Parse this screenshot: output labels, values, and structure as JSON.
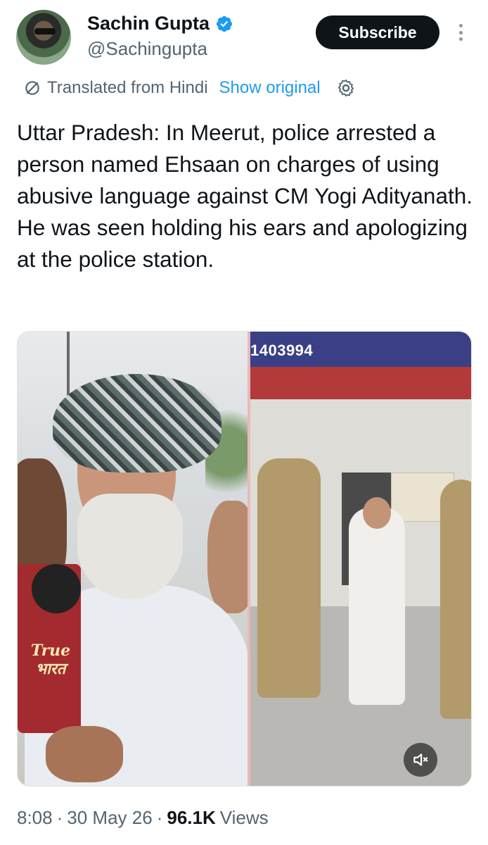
{
  "author": {
    "display_name": "Sachin Gupta",
    "handle": "@Sachingupta",
    "verified": true,
    "avatar_icon": "profile-avatar"
  },
  "actions": {
    "subscribe_label": "Subscribe",
    "more_icon": "vertical-ellipsis-icon"
  },
  "translation": {
    "note": "Translated from Hindi",
    "show_original_label": "Show original",
    "settings_icon": "gear-icon"
  },
  "tweet": {
    "text": "Uttar Pradesh: In Meerut, police arrested a person named Ehsaan on charges of using abusive language against CM Yogi Adityanath. He was seen holding his ears and apologizing at the police station."
  },
  "media": {
    "left_mic_label_line1": "True",
    "left_mic_label_line2": "भारत",
    "right_banner_number": "1403994",
    "mute_icon": "volume-muted-icon"
  },
  "meta": {
    "time": "8:08",
    "separator": "·",
    "date": "30 May 26",
    "views_count": "96.1K",
    "views_label": "Views"
  },
  "colors": {
    "text_primary": "#0f1419",
    "text_secondary": "#536471",
    "link": "#1d9bf0",
    "verified": "#1d9bf0",
    "subscribe_bg": "#0f1419"
  }
}
